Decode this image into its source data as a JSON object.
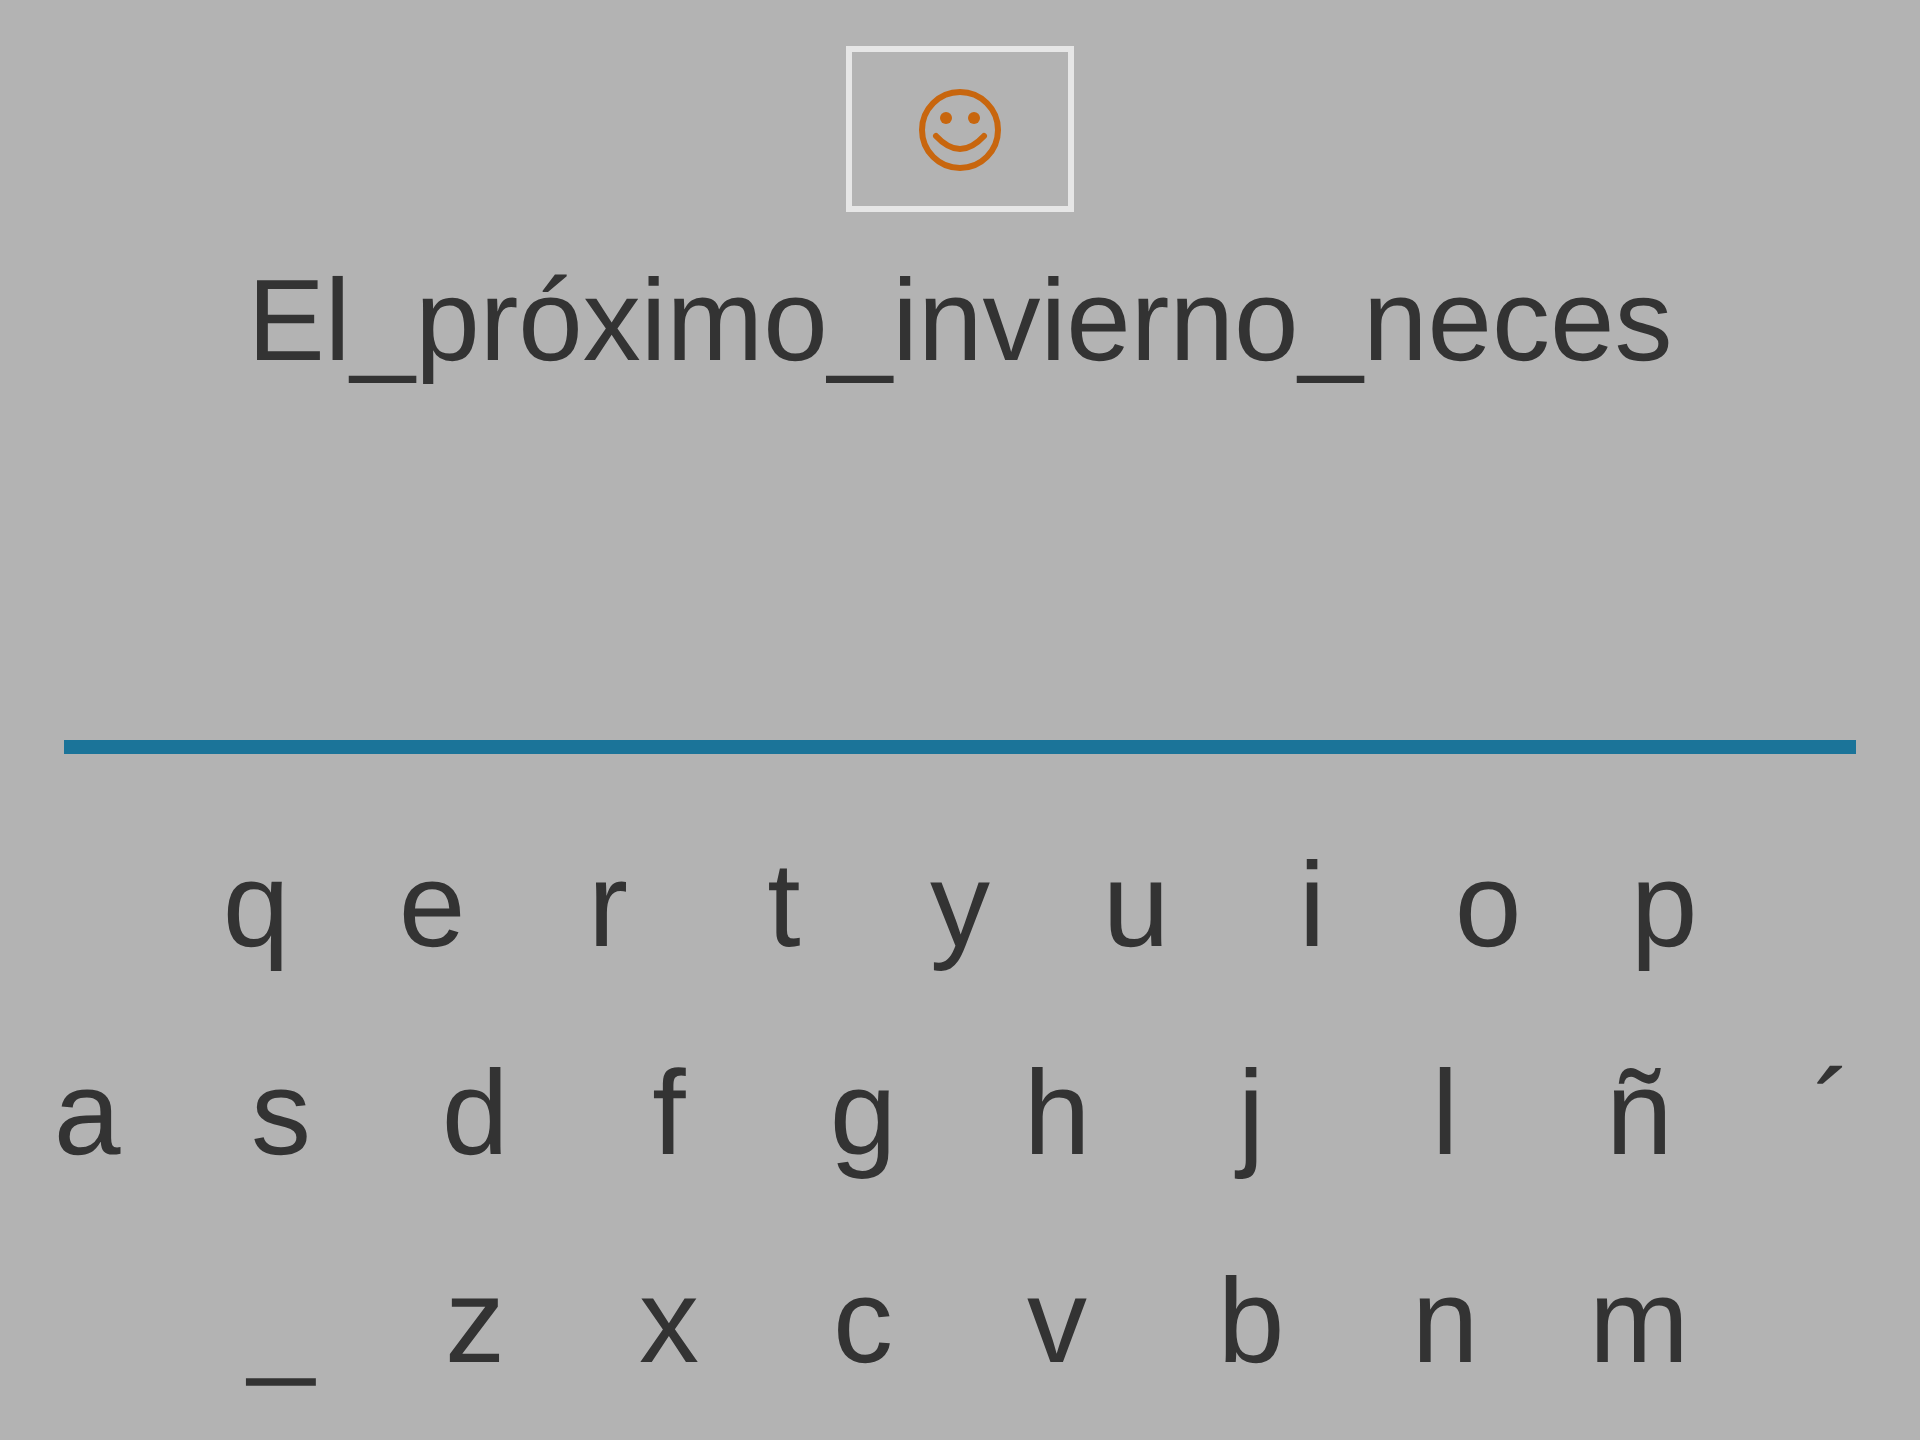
{
  "prompt": "El_próximo_invierno_neces",
  "keyboard": [
    [
      "q",
      "e",
      "r",
      "t",
      "y",
      "u",
      "i",
      "o",
      "p"
    ],
    [
      "a",
      "s",
      "d",
      "f",
      "g",
      "h",
      "j",
      "l",
      "ñ",
      "´"
    ],
    [
      "_",
      "z",
      "x",
      "c",
      "v",
      "b",
      "n",
      "m"
    ]
  ]
}
